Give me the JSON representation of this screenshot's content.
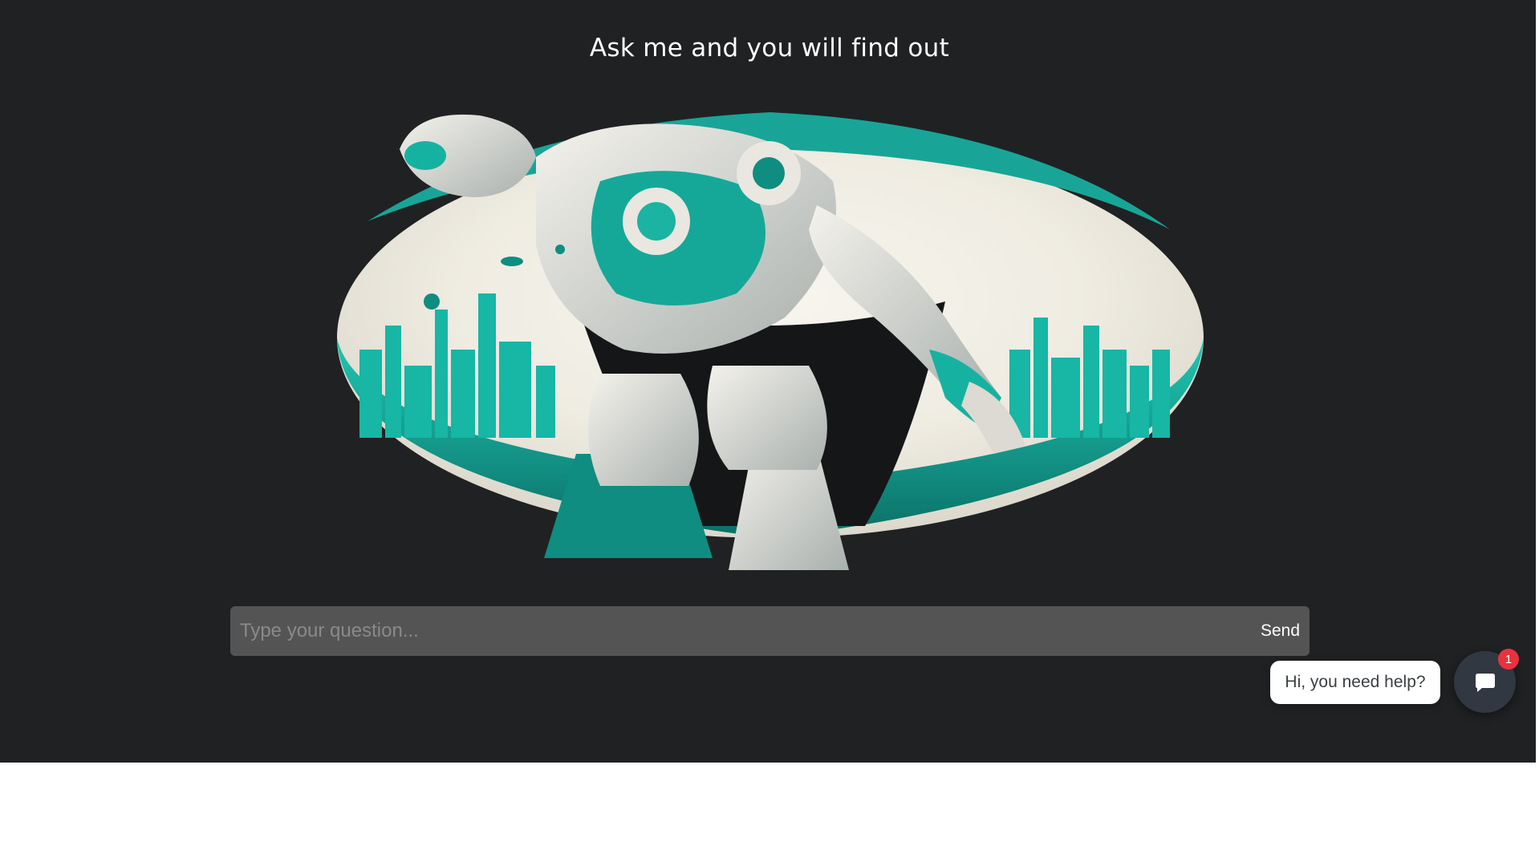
{
  "page": {
    "title": "Ask me and you will find out"
  },
  "hero": {
    "icon": "robot-illustration",
    "accent_color": "#14b8a6",
    "light_color": "#f3f1ea"
  },
  "question": {
    "placeholder": "Type your question...",
    "value": "",
    "send_label": "Send"
  },
  "chat_widget": {
    "greeting": "Hi, you need help?",
    "icon": "chat-bubble-icon",
    "unread_count": "1",
    "badge_color": "#e8333e"
  },
  "colors": {
    "background": "#202123",
    "input_background": "#545454",
    "launcher": "#313842"
  }
}
